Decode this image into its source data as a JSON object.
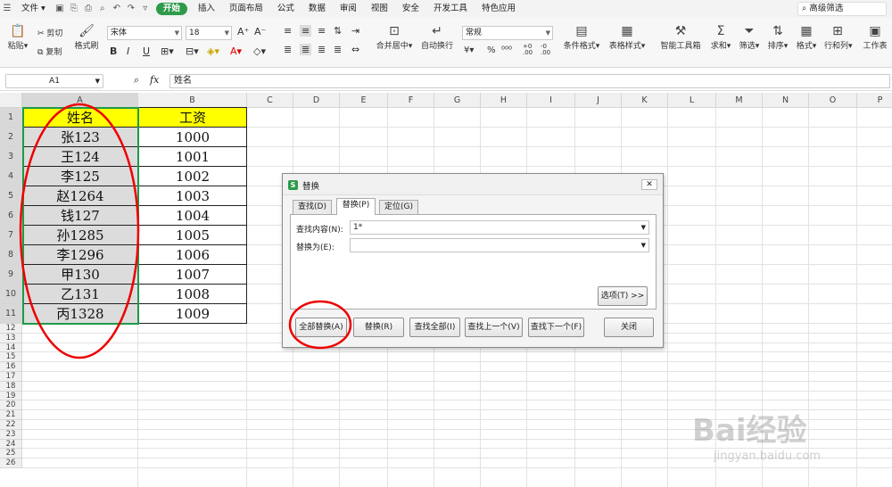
{
  "menubar": {
    "file_label": "文件",
    "tabs": [
      {
        "label": "开始",
        "active": true
      },
      {
        "label": "插入"
      },
      {
        "label": "页面布局"
      },
      {
        "label": "公式"
      },
      {
        "label": "数据"
      },
      {
        "label": "审阅"
      },
      {
        "label": "视图"
      },
      {
        "label": "安全"
      },
      {
        "label": "开发工具"
      },
      {
        "label": "特色应用"
      }
    ],
    "search_label": "高级筛选"
  },
  "ribbon": {
    "paste": "粘贴",
    "cut": "剪切",
    "copy": "复制",
    "format_painter": "格式刷",
    "font_name": "宋体",
    "font_size": "18",
    "merge_center": "合并居中",
    "wrap_text": "自动换行",
    "number_format": "常规",
    "conditional_format": "条件格式",
    "table_style": "表格样式",
    "smart_toolbox": "智能工具箱",
    "sum": "求和",
    "filter": "筛选",
    "sort": "排序",
    "format": "格式",
    "rows_cols": "行和列",
    "worksheet": "工作表"
  },
  "formula_bar": {
    "cell_ref": "A1",
    "fx": "fx",
    "content": "姓名"
  },
  "grid": {
    "columns": [
      "A",
      "B",
      "C",
      "D",
      "E",
      "F",
      "G",
      "H",
      "I",
      "J",
      "K",
      "L",
      "M",
      "N",
      "O",
      "P"
    ],
    "rows": [
      "1",
      "2",
      "3",
      "4",
      "5",
      "6",
      "7",
      "8",
      "9",
      "10",
      "11",
      "12",
      "13",
      "14",
      "15",
      "16",
      "17",
      "18",
      "19",
      "20",
      "21",
      "22",
      "23",
      "24",
      "25",
      "26"
    ],
    "header_a": "姓名",
    "header_b": "工资",
    "names": [
      "张123",
      "王124",
      "李125",
      "赵1264",
      "钱127",
      "孙1285",
      "李1296",
      "甲130",
      "乙131",
      "丙1328"
    ],
    "salaries": [
      "1000",
      "1001",
      "1002",
      "1003",
      "1004",
      "1005",
      "1006",
      "1007",
      "1008",
      "1009"
    ],
    "header_fill": "#ffff00"
  },
  "dialog": {
    "title": "替换",
    "tabs": [
      "查找(D)",
      "替换(P)",
      "定位(G)"
    ],
    "find_label": "查找内容(N):",
    "find_value": "1*",
    "replace_label": "替换为(E):",
    "replace_value": "",
    "options_button": "选项(T) >>",
    "buttons": {
      "replace_all": "全部替换(A)",
      "replace": "替换(R)",
      "find_all": "查找全部(I)",
      "find_prev": "查找上一个(V)",
      "find_next": "查找下一个(F)",
      "close": "关闭"
    }
  },
  "watermark": {
    "brand": "Bai经验",
    "url": "jingyan.baidu.com"
  }
}
